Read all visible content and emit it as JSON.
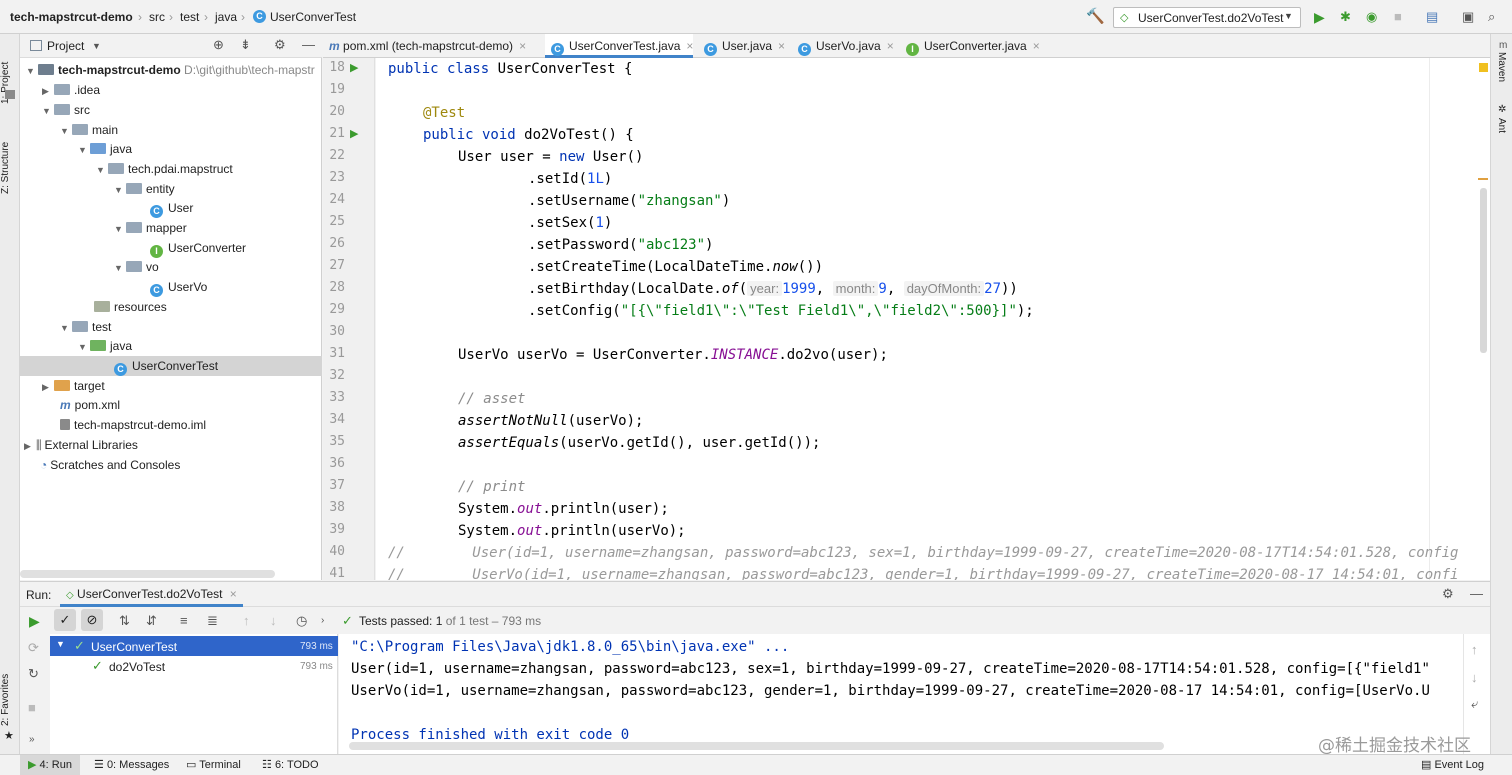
{
  "breadcrumb": [
    "tech-mapstrcut-demo",
    "src",
    "test",
    "java",
    "UserConverTest"
  ],
  "run_config": "UserConverTest.do2VoTest",
  "left_strip": {
    "project": "1: Project",
    "structure": "Z: Structure",
    "favorites": "2: Favorites"
  },
  "right_strip": {
    "maven": "Maven",
    "ant": "Ant"
  },
  "project_panel": {
    "title": "Project",
    "root": "tech-mapstrcut-demo",
    "root_path": "D:\\git\\github\\tech-mapstr",
    "items": [
      {
        "label": "tech-mapstrcut-demo"
      },
      {
        "label": ".idea"
      },
      {
        "label": "src"
      },
      {
        "label": "main"
      },
      {
        "label": "java"
      },
      {
        "label": "tech.pdai.mapstruct"
      },
      {
        "label": "entity"
      },
      {
        "label": "User"
      },
      {
        "label": "mapper"
      },
      {
        "label": "UserConverter"
      },
      {
        "label": "vo"
      },
      {
        "label": "UserVo"
      },
      {
        "label": "resources"
      },
      {
        "label": "test"
      },
      {
        "label": "java"
      },
      {
        "label": "UserConverTest"
      },
      {
        "label": "target"
      },
      {
        "label": "pom.xml"
      },
      {
        "label": "tech-mapstrcut-demo.iml"
      },
      {
        "label": "External Libraries"
      },
      {
        "label": "Scratches and Consoles"
      }
    ]
  },
  "editor_tabs": [
    {
      "label": "pom.xml (tech-mapstrcut-demo)"
    },
    {
      "label": "UserConverTest.java"
    },
    {
      "label": "User.java"
    },
    {
      "label": "UserVo.java"
    },
    {
      "label": "UserConverter.java"
    }
  ],
  "line_numbers": [
    "18",
    "19",
    "20",
    "21",
    "22",
    "23",
    "24",
    "25",
    "26",
    "27",
    "28",
    "29",
    "30",
    "31",
    "32",
    "33",
    "34",
    "35",
    "36",
    "37",
    "38",
    "39",
    "40",
    "41"
  ],
  "code": {
    "l18a": "public class ",
    "l18b": "UserConverTest {",
    "l20": "@Test",
    "l21a": "public void ",
    "l21b": "do2VoTest() {",
    "l22a": "User user = ",
    "l22b": "new ",
    "l22c": "User()",
    "l23a": ".setId(",
    "l23b": "1L",
    "l23c": ")",
    "l24a": ".setUsername(",
    "l24b": "\"zhangsan\"",
    "l24c": ")",
    "l25a": ".setSex(",
    "l25b": "1",
    "l25c": ")",
    "l26a": ".setPassword(",
    "l26b": "\"abc123\"",
    "l26c": ")",
    "l27a": ".setCreateTime(LocalDateTime.",
    "l27b": "now",
    "l27c": "())",
    "l28a": ".setBirthday(LocalDate.",
    "l28b": "of",
    "l28c": "(",
    "l28h1": "year:",
    "l28v1": "1999",
    "l28s1": ", ",
    "l28h2": "month:",
    "l28v2": "9",
    "l28s2": ", ",
    "l28h3": "dayOfMonth:",
    "l28v3": "27",
    "l28e": "))",
    "l29a": ".setConfig(",
    "l29b": "\"[{\\\"field1\\\":\\\"Test Field1\\\",\\\"field2\\\":500}]\"",
    "l29c": ");",
    "l31a": "UserVo userVo = UserConverter.",
    "l31b": "INSTANCE",
    "l31c": ".do2vo(user);",
    "l33": "// asset",
    "l34a": "assertNotNull",
    "l34b": "(userVo);",
    "l35a": "assertEquals",
    "l35b": "(userVo.getId(), user.getId());",
    "l37": "// print",
    "l38a": "System.",
    "l38b": "out",
    "l38c": ".println(user);",
    "l39a": "System.",
    "l39b": "out",
    "l39c": ".println(userVo);",
    "l40": "//        User(id=1, username=zhangsan, password=abc123, sex=1, birthday=1999-09-27, createTime=2020-08-17T14:54:01.528, config",
    "l41": "//        UserVo(id=1, username=zhangsan, password=abc123, gender=1, birthday=1999-09-27, createTime=2020-08-17 14:54:01, confi"
  },
  "run_panel": {
    "label": "Run:",
    "tab": "UserConverTest.do2VoTest",
    "status_prefix": "Tests passed:",
    "status_count": "1",
    "status_rest": "of 1 test – 793 ms",
    "tests": [
      {
        "name": "UserConverTest",
        "time": "793 ms"
      },
      {
        "name": "do2VoTest",
        "time": "793 ms"
      }
    ]
  },
  "console": [
    "\"C:\\Program Files\\Java\\jdk1.8.0_65\\bin\\java.exe\" ...",
    "User(id=1, username=zhangsan, password=abc123, sex=1, birthday=1999-09-27, createTime=2020-08-17T14:54:01.528, config=[{\"field1\"",
    "UserVo(id=1, username=zhangsan, password=abc123, gender=1, birthday=1999-09-27, createTime=2020-08-17 14:54:01, config=[UserVo.U",
    "",
    "Process finished with exit code 0"
  ],
  "bottom_tabs": {
    "run": "4: Run",
    "messages": "0: Messages",
    "terminal": "Terminal",
    "todo": "6: TODO",
    "event_log": "Event Log"
  },
  "watermark": "@稀土掘金技术社区"
}
